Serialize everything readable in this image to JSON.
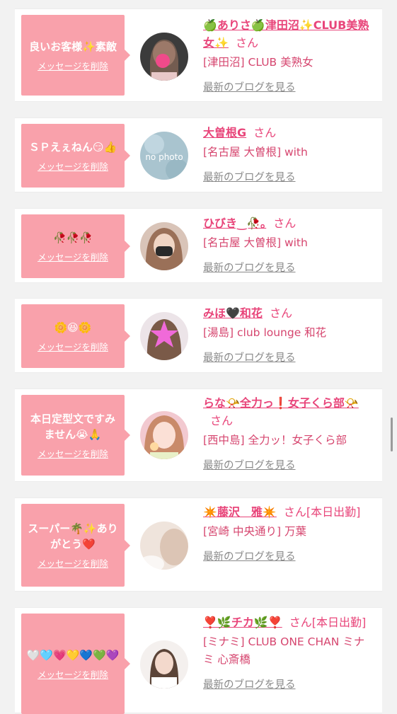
{
  "delete_label": "メッセージを削除",
  "blog_label": "最新のブログを見る",
  "colors": {
    "bubble": "#f9a1ab",
    "name": "#e8457a",
    "link_gray": "#8a8a8a"
  },
  "cards": [
    {
      "message": "良いお客様✨素敵",
      "name": "🍏ありさ🍏津田沼✨CLUB美熟女✨",
      "suffix": "さん",
      "shop": "[津田沼] CLUB 美熟女",
      "avatar": "photo"
    },
    {
      "message": "ＳＰえぇねん😏👍",
      "name": "大曽根G",
      "suffix": "さん",
      "shop": "[名古屋 大曽根] with",
      "avatar": "no photo"
    },
    {
      "message": "🥀🥀🥀",
      "name": "ひびき‿🥀｡",
      "suffix": "さん",
      "shop": "[名古屋 大曽根] with",
      "avatar": "photo"
    },
    {
      "message": "🌼😆🌼",
      "name": "みほ🖤和花",
      "suffix": "さん",
      "shop": "[湯島] club lounge 和花",
      "avatar": "photo"
    },
    {
      "message": "本日定型文ですみません😭🙏",
      "name": "らな📯全力っ❗女子くら部📯",
      "suffix": "さん",
      "shop": "[西中島] 全力ッ！女子くら部",
      "avatar": "photo"
    },
    {
      "message": "スーパー🌴✨ありがとう❤️",
      "name": "✴️藤沢　雅✴️",
      "suffix": "さん[本日出勤]",
      "shop": "[宮崎 中央通り] 万葉",
      "avatar": "photo"
    },
    {
      "message": "🤍🩵💗💛💙💚💜",
      "name": "❣️🌿チカ🌿❣️",
      "suffix": "さん[本日出勤]",
      "shop": "[ミナミ] CLUB ONE CHAN ミナミ 心斎橋",
      "avatar": "photo"
    }
  ]
}
